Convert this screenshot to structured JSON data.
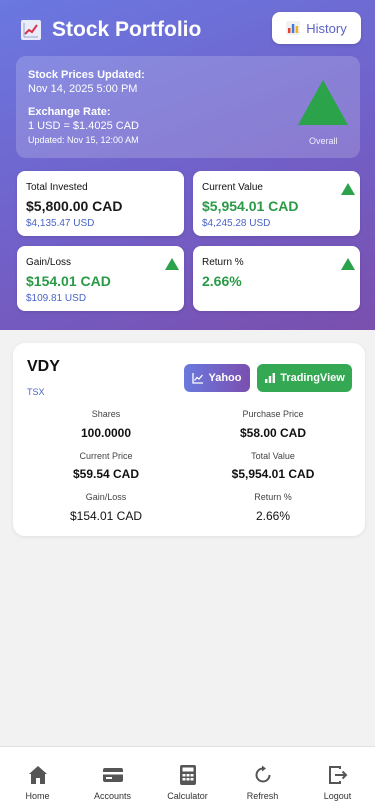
{
  "header": {
    "title": "Stock Portfolio",
    "title_icon": "chart-increasing-icon",
    "history_label": "History",
    "history_icon": "bar-chart-icon"
  },
  "update_panel": {
    "prices_label": "Stock Prices Updated:",
    "prices_value": "Nov 14, 2025 5:00 PM",
    "rate_label": "Exchange Rate:",
    "rate_value": "1 USD = $1.4025 CAD",
    "rate_updated": "Updated: Nov 15, 12:00 AM",
    "overall_label": "Overall",
    "overall_trend": "up"
  },
  "stats": {
    "invested": {
      "label": "Total Invested",
      "main": "$5,800.00 CAD",
      "sub": "$4,135.47 USD"
    },
    "current": {
      "label": "Current Value",
      "main": "$5,954.01 CAD",
      "sub": "$4,245.28 USD",
      "trend": "up"
    },
    "gain": {
      "label": "Gain/Loss",
      "main": "$154.01 CAD",
      "sub": "$109.81 USD",
      "trend": "up"
    },
    "return": {
      "label": "Return %",
      "main": "2.66%",
      "trend": "up"
    }
  },
  "holding": {
    "ticker": "VDY",
    "exchange": "TSX",
    "yahoo_label": "Yahoo",
    "tradingview_label": "TradingView",
    "shares_label": "Shares",
    "shares_value": "100.0000",
    "purchase_label": "Purchase Price",
    "purchase_value": "$58.00 CAD",
    "current_label": "Current Price",
    "current_value": "$59.54 CAD",
    "total_label": "Total Value",
    "total_value": "$5,954.01 CAD",
    "gain_label": "Gain/Loss",
    "gain_value": "$154.01 CAD",
    "return_label": "Return %",
    "return_value": "2.66%"
  },
  "nav": {
    "home": "Home",
    "accounts": "Accounts",
    "calculator": "Calculator",
    "refresh": "Refresh",
    "logout": "Logout"
  },
  "colors": {
    "gradient_start": "#6a78e0",
    "gradient_end": "#7a4fae",
    "positive": "#2a9a47",
    "usd_text": "#4a63c8",
    "tradingview": "#34a853"
  }
}
